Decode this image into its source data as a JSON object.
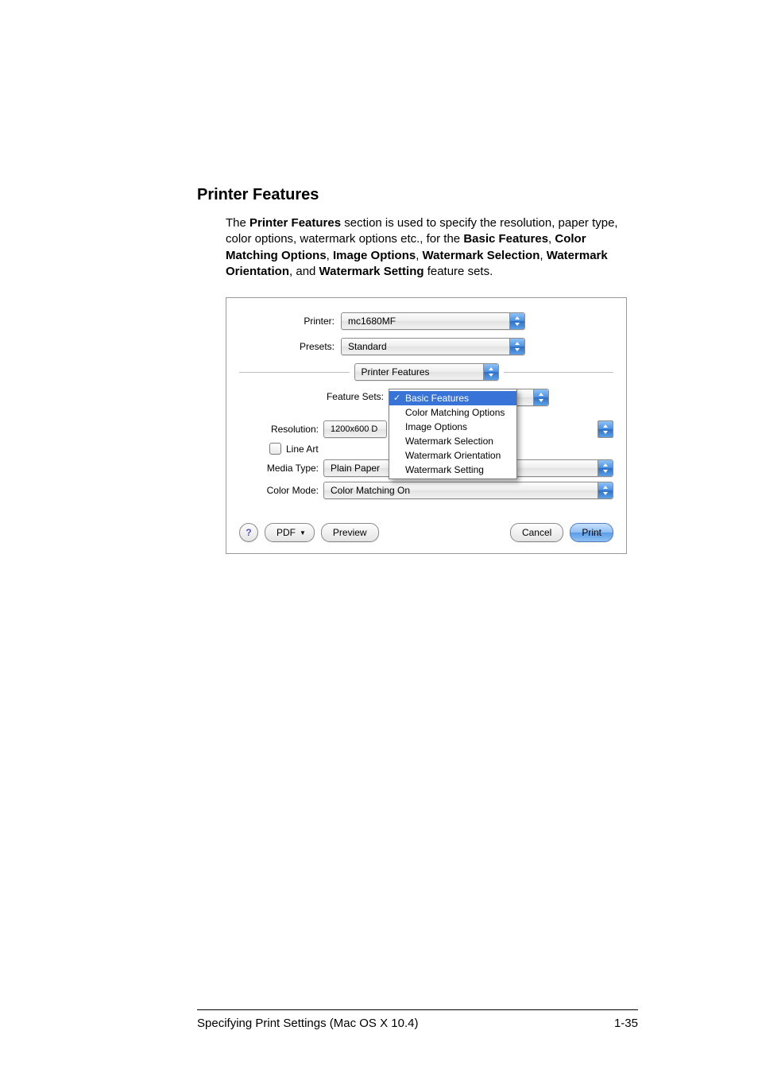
{
  "heading": "Printer Features",
  "para": {
    "t1": "The ",
    "b1": "Printer Features",
    "t2": " section is used to specify the resolution, paper type, color options, watermark options etc., for the ",
    "b2": "Basic Features",
    "t3": ", ",
    "b3": "Color Matching Options",
    "t4": ", ",
    "b4": "Image Options",
    "t5": ", ",
    "b5": "Watermark Selection",
    "t6": ", ",
    "b6": "Watermark Orientation",
    "t7": ", and ",
    "b7": "Watermark Setting",
    "t8": " feature sets."
  },
  "dialog": {
    "printerLabel": "Printer:",
    "printerValue": "mc1680MF",
    "presetsLabel": "Presets:",
    "presetsValue": "Standard",
    "paneValue": "Printer Features",
    "featureSetsLabel": "Feature Sets:",
    "menu": {
      "items": [
        "Basic Features",
        "Color Matching Options",
        "Image Options",
        "Watermark Selection",
        "Watermark Orientation",
        "Watermark Setting"
      ],
      "check": "✓"
    },
    "resolutionLabel": "Resolution:",
    "resolutionValue": "1200x600 D",
    "lineArtLabel": "Line Art",
    "mediaTypeLabel": "Media Type:",
    "mediaTypeValue": "Plain Paper",
    "colorModeLabel": "Color Mode:",
    "colorModeValue": "Color Matching On",
    "helpGlyph": "?",
    "pdfLabel": "PDF",
    "pdfTri": "▼",
    "previewLabel": "Preview",
    "cancelLabel": "Cancel",
    "printLabel": "Print"
  },
  "footer": {
    "left": "Specifying Print Settings (Mac OS X 10.4)",
    "right": "1-35"
  }
}
